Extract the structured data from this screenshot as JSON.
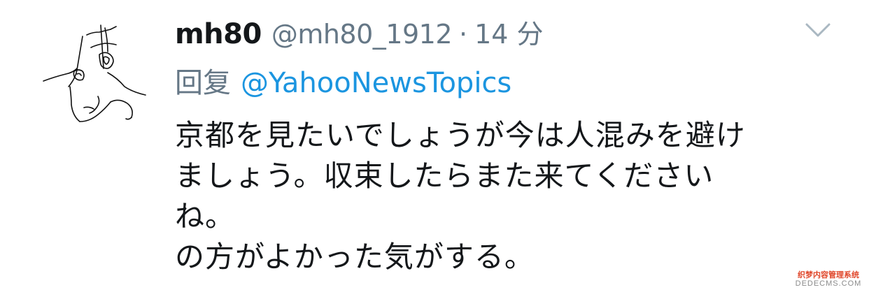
{
  "tweet": {
    "display_name": "mh80",
    "handle": "@mh80_1912",
    "separator": "·",
    "time": "14 分",
    "reply_prefix": "回复",
    "reply_to": "@YahooNewsTopics",
    "body_lines": [
      "京都を見たいでしょうが今は人混みを避け",
      "ましょう。収束したらまた来てください",
      "ね。",
      "の方がよかった気がする。"
    ],
    "menu_icon": "chevron-down-icon",
    "avatar_icon": "hand-drawn-avatar"
  },
  "watermark": {
    "top": "织梦内容管理系统",
    "bottom": "DEDECMS.COM"
  },
  "colors": {
    "name": "#14171a",
    "secondary": "#657786",
    "link": "#1b95e0",
    "chevron": "#aab8c2"
  }
}
